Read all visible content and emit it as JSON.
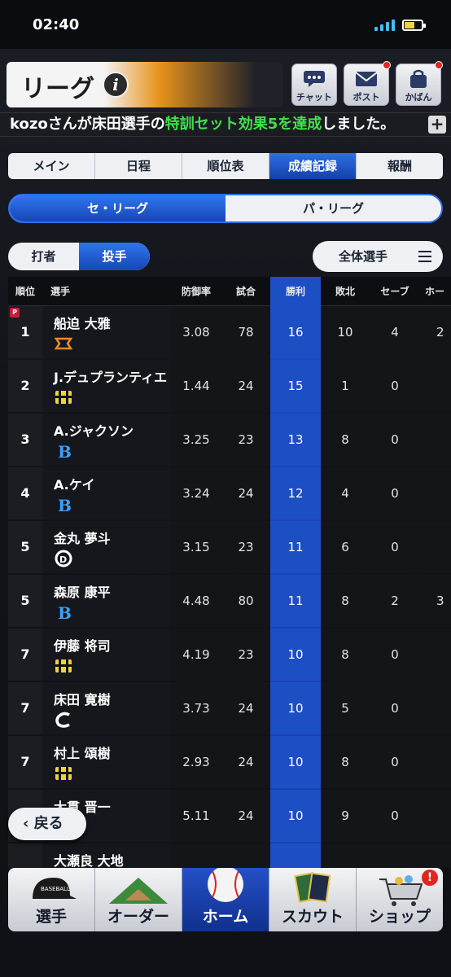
{
  "status": {
    "time": "02:40"
  },
  "header": {
    "title": "リーグ"
  },
  "top_buttons": {
    "chat": "チャット",
    "post": "ポスト",
    "bag": "かばん"
  },
  "ticker": {
    "pre": "kozoさんが床田選手の",
    "highlight": "特訓セット効果5を達成",
    "post": "しました。"
  },
  "tabs": [
    "メイン",
    "日程",
    "順位表",
    "成績記録",
    "報酬"
  ],
  "league_tabs": [
    "セ・リーグ",
    "パ・リーグ"
  ],
  "player_type": [
    "打者",
    "投手"
  ],
  "filter_label": "全体選手",
  "columns": [
    "順位",
    "選手",
    "防御率",
    "試合",
    "勝利",
    "敗北",
    "セーブ",
    "ホー"
  ],
  "rows": [
    {
      "rank": "1",
      "name": "船迫 大雅",
      "team": "giants",
      "era": "3.08",
      "games": "78",
      "wins": "16",
      "losses": "10",
      "saves": "4",
      "holds": "2",
      "badge": "P"
    },
    {
      "rank": "2",
      "name": "J.デュプランティエ",
      "team": "tigers",
      "era": "1.44",
      "games": "24",
      "wins": "15",
      "losses": "1",
      "saves": "0",
      "holds": ""
    },
    {
      "rank": "3",
      "name": "A.ジャクソン",
      "team": "baystars",
      "era": "3.25",
      "games": "23",
      "wins": "13",
      "losses": "8",
      "saves": "0",
      "holds": ""
    },
    {
      "rank": "4",
      "name": "A.ケイ",
      "team": "baystars",
      "era": "3.24",
      "games": "24",
      "wins": "12",
      "losses": "4",
      "saves": "0",
      "holds": ""
    },
    {
      "rank": "5",
      "name": "金丸 夢斗",
      "team": "dragons",
      "era": "3.15",
      "games": "23",
      "wins": "11",
      "losses": "6",
      "saves": "0",
      "holds": ""
    },
    {
      "rank": "5",
      "name": "森原 康平",
      "team": "baystars",
      "era": "4.48",
      "games": "80",
      "wins": "11",
      "losses": "8",
      "saves": "2",
      "holds": "3"
    },
    {
      "rank": "7",
      "name": "伊藤 将司",
      "team": "tigers",
      "era": "4.19",
      "games": "23",
      "wins": "10",
      "losses": "8",
      "saves": "0",
      "holds": ""
    },
    {
      "rank": "7",
      "name": "床田 寛樹",
      "team": "carp",
      "era": "3.73",
      "games": "24",
      "wins": "10",
      "losses": "5",
      "saves": "0",
      "holds": ""
    },
    {
      "rank": "7",
      "name": "村上 頌樹",
      "team": "tigers",
      "era": "2.93",
      "games": "24",
      "wins": "10",
      "losses": "8",
      "saves": "0",
      "holds": ""
    },
    {
      "rank": "7",
      "name": "大貫 晋一",
      "team": "baystars",
      "era": "5.11",
      "games": "24",
      "wins": "10",
      "losses": "9",
      "saves": "0",
      "holds": ""
    },
    {
      "rank": "",
      "name": "大瀬良 大地",
      "team": "carp",
      "era": "",
      "games": "",
      "wins": "",
      "losses": "",
      "saves": "",
      "holds": ""
    }
  ],
  "back_label": "戻る",
  "nav": [
    "選手",
    "オーダー",
    "ホーム",
    "スカウト",
    "ショップ"
  ],
  "colors": {
    "accent": "#1d4fc4",
    "alert": "#e0261f",
    "highlight": "#3ee24a"
  }
}
